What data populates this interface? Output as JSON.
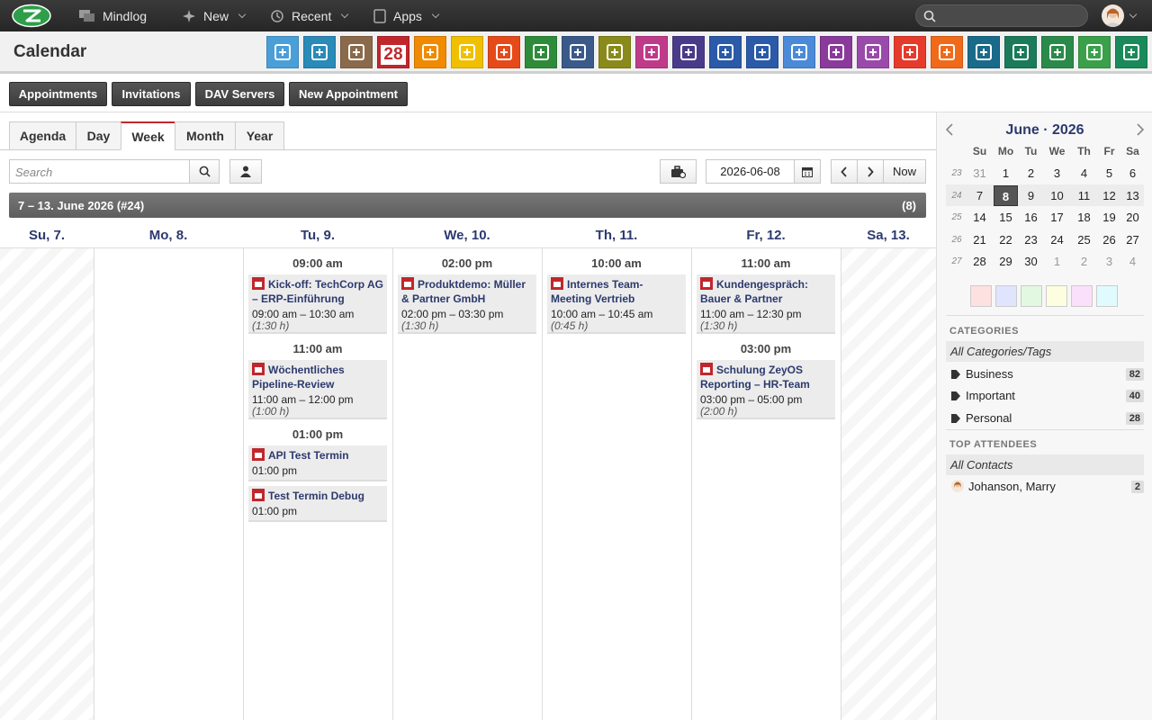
{
  "topbar": {
    "mindlog": "Mindlog",
    "new": "New",
    "recent": "Recent",
    "apps": "Apps",
    "search_placeholder": ""
  },
  "header": {
    "title": "Calendar",
    "calendar_icon_number": "28",
    "app_icons": [
      {
        "name": "mail-icon",
        "color": "#4a9fd8"
      },
      {
        "name": "address-icon",
        "color": "#2a8ab8"
      },
      {
        "name": "contacts-icon",
        "color": "#8a6a4a"
      },
      {
        "name": "calendar-icon",
        "color": "#c0272d"
      },
      {
        "name": "timer-icon",
        "color": "#f08a00"
      },
      {
        "name": "tasks-icon",
        "color": "#f0c000"
      },
      {
        "name": "projects-icon",
        "color": "#e64a19"
      },
      {
        "name": "notes-icon",
        "color": "#2e8b3a"
      },
      {
        "name": "bookmark-icon",
        "color": "#3a5a8a"
      },
      {
        "name": "documents-icon",
        "color": "#8a8a1a"
      },
      {
        "name": "sales-icon",
        "color": "#c03a8a"
      },
      {
        "name": "payments-icon",
        "color": "#4a3a8a"
      },
      {
        "name": "shipping-icon",
        "color": "#2a5aa8"
      },
      {
        "name": "support-icon",
        "color": "#2a5aa8"
      },
      {
        "name": "finance-icon",
        "color": "#4a8ad8"
      },
      {
        "name": "contracts-icon",
        "color": "#8a3a9a"
      },
      {
        "name": "deals-icon",
        "color": "#9a4aaa"
      },
      {
        "name": "pdf-icon",
        "color": "#e63a2a"
      },
      {
        "name": "broadcast-icon",
        "color": "#f06a1a"
      },
      {
        "name": "download-icon",
        "color": "#1a6a8a"
      },
      {
        "name": "cart-icon",
        "color": "#1a7a5a"
      },
      {
        "name": "money-icon",
        "color": "#2a8a4a"
      },
      {
        "name": "pricetag-icon",
        "color": "#3aa04a"
      },
      {
        "name": "database-icon",
        "color": "#1a8a5a"
      }
    ]
  },
  "subbar": {
    "appointments": "Appointments",
    "invitations": "Invitations",
    "dav_servers": "DAV Servers",
    "new_appointment": "New Appointment"
  },
  "tabs": [
    "Agenda",
    "Day",
    "Week",
    "Month",
    "Year"
  ],
  "active_tab": "Week",
  "toolbar": {
    "search_placeholder": "Search",
    "date": "2026-06-08",
    "now": "Now"
  },
  "week_bar": {
    "range": "7 – 13. June 2026 (#24)",
    "count": "(8)"
  },
  "days": [
    "Su, 7.",
    "Mo, 8.",
    "Tu, 9.",
    "We, 10.",
    "Th, 11.",
    "Fr, 12.",
    "Sa, 13."
  ],
  "tuesday": {
    "t1": "09:00 am",
    "a1_title": "Kick-off: TechCorp AG – ERP-Einführung",
    "a1_time": "09:00 am – 10:30 am",
    "a1_dur": "(1:30 h)",
    "t2": "11:00 am",
    "a2_title": "Wöchentliches Pipeline-Review",
    "a2_time": "11:00 am – 12:00 pm",
    "a2_dur": "(1:00 h)",
    "t3": "01:00 pm",
    "a3_title": "API Test Termin",
    "a3_time": "01:00 pm",
    "a4_title": "Test Termin Debug",
    "a4_time": "01:00 pm"
  },
  "wednesday": {
    "t1": "02:00 pm",
    "a1_title": "Produktdemo: Müller & Partner GmbH",
    "a1_time": "02:00 pm – 03:30 pm",
    "a1_dur": "(1:30 h)"
  },
  "thursday": {
    "t1": "10:00 am",
    "a1_title": "Internes Team-Meeting Vertrieb",
    "a1_time": "10:00 am – 10:45 am",
    "a1_dur": "(0:45 h)"
  },
  "friday": {
    "t1": "11:00 am",
    "a1_title": "Kundengespräch: Bauer & Partner",
    "a1_time": "11:00 am – 12:30 pm",
    "a1_dur": "(1:30 h)",
    "t2": "03:00 pm",
    "a2_title": "Schulung ZeyOS Reporting – HR-Team",
    "a2_time": "03:00 pm – 05:00 pm",
    "a2_dur": "(2:00 h)"
  },
  "mini_calendar": {
    "title": "June · 2026",
    "weekdays": [
      "Su",
      "Mo",
      "Tu",
      "We",
      "Th",
      "Fr",
      "Sa"
    ],
    "weeks": [
      {
        "num": "23",
        "days": [
          "31",
          "1",
          "2",
          "3",
          "4",
          "5",
          "6"
        ]
      },
      {
        "num": "24",
        "days": [
          "7",
          "8",
          "9",
          "10",
          "11",
          "12",
          "13"
        ]
      },
      {
        "num": "25",
        "days": [
          "14",
          "15",
          "16",
          "17",
          "18",
          "19",
          "20"
        ]
      },
      {
        "num": "26",
        "days": [
          "21",
          "22",
          "23",
          "24",
          "25",
          "26",
          "27"
        ]
      },
      {
        "num": "27",
        "days": [
          "28",
          "29",
          "30",
          "1",
          "2",
          "3",
          "4"
        ]
      }
    ],
    "today": "8",
    "swatches": [
      "#fde0e0",
      "#e0e4fd",
      "#e2f8e0",
      "#fdfde0",
      "#fbe0fb",
      "#e0fbfd"
    ]
  },
  "categories": {
    "heading": "CATEGORIES",
    "all": "All Categories/Tags",
    "items": [
      {
        "label": "Business",
        "count": "82"
      },
      {
        "label": "Important",
        "count": "40"
      },
      {
        "label": "Personal",
        "count": "28"
      }
    ]
  },
  "attendees": {
    "heading": "TOP ATTENDEES",
    "all": "All Contacts",
    "items": [
      {
        "label": "Johanson, Marry",
        "count": "2"
      }
    ]
  }
}
